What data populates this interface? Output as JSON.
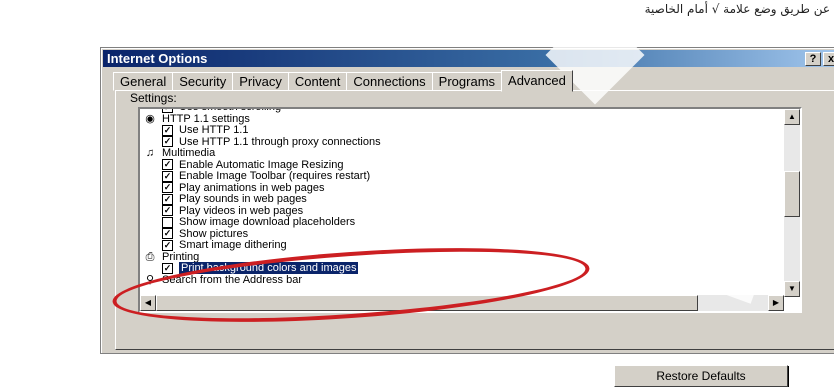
{
  "caption": "عن طريق وضع علامة √ أمام الخاصية",
  "window": {
    "title": "Internet Options",
    "help_btn": "?",
    "close_btn": "x"
  },
  "tabs": [
    {
      "label": "General"
    },
    {
      "label": "Security"
    },
    {
      "label": "Privacy"
    },
    {
      "label": "Content"
    },
    {
      "label": "Connections"
    },
    {
      "label": "Programs"
    },
    {
      "label": "Advanced"
    }
  ],
  "settings_label": "Settings:",
  "items": [
    {
      "label": "Use smooth scrolling",
      "type": "checkbox",
      "checked": true
    },
    {
      "label": "HTTP 1.1 settings",
      "type": "group",
      "icon": "globe-icon"
    },
    {
      "label": "Use HTTP 1.1",
      "type": "checkbox",
      "checked": true
    },
    {
      "label": "Use HTTP 1.1 through proxy connections",
      "type": "checkbox",
      "checked": true
    },
    {
      "label": "Multimedia",
      "type": "group",
      "icon": "multimedia-icon"
    },
    {
      "label": "Enable Automatic Image Resizing",
      "type": "checkbox",
      "checked": true
    },
    {
      "label": "Enable Image Toolbar (requires restart)",
      "type": "checkbox",
      "checked": true
    },
    {
      "label": "Play animations in web pages",
      "type": "checkbox",
      "checked": true
    },
    {
      "label": "Play sounds in web pages",
      "type": "checkbox",
      "checked": true
    },
    {
      "label": "Play videos in web pages",
      "type": "checkbox",
      "checked": true
    },
    {
      "label": "Show image download placeholders",
      "type": "checkbox",
      "checked": false
    },
    {
      "label": "Show pictures",
      "type": "checkbox",
      "checked": true
    },
    {
      "label": "Smart image dithering",
      "type": "checkbox",
      "checked": true
    },
    {
      "label": "Printing",
      "type": "group",
      "icon": "printer-icon"
    },
    {
      "label": "Print background colors and images",
      "type": "checkbox",
      "checked": true,
      "selected": true
    },
    {
      "label": "Search from the Address bar",
      "type": "group",
      "icon": "magnifier-icon"
    }
  ],
  "restore_button": "Restore Defaults",
  "colors": {
    "highlight": "#0a246a",
    "annotation_ring": "#cc1f22",
    "dialog_face": "#d4d0c8"
  }
}
